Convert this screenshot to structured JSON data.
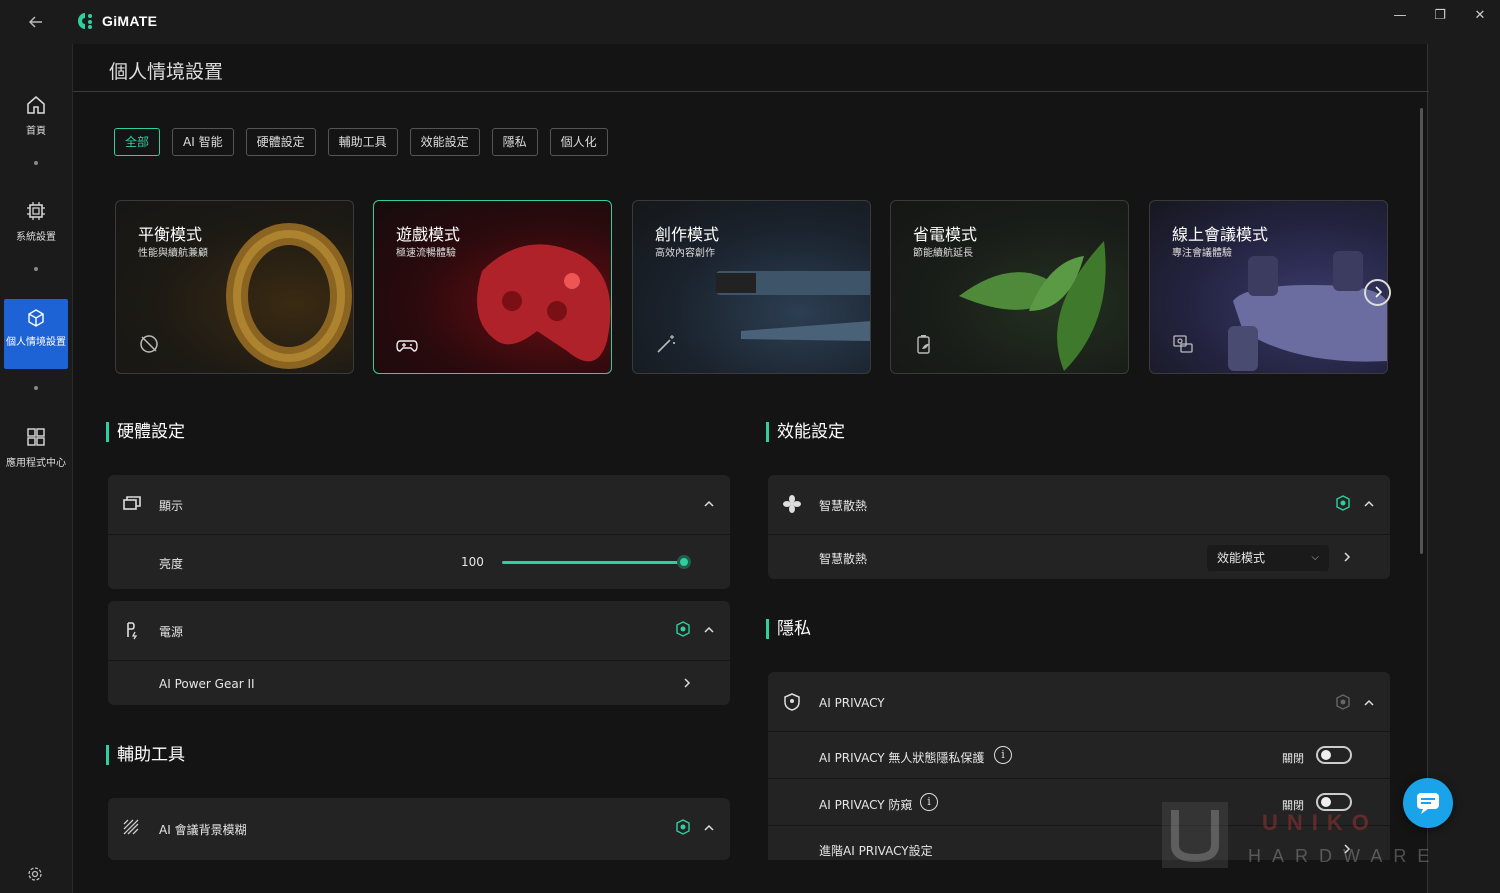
{
  "app": {
    "name": "GiMATE"
  },
  "window": {
    "minimize": "—",
    "restore": "❐",
    "close": "✕"
  },
  "sidebar": {
    "items": [
      {
        "label": "首頁",
        "icon": "home-icon"
      },
      {
        "label": "系統設置",
        "icon": "chip-icon"
      },
      {
        "label": "個人情境設置",
        "icon": "cube-icon"
      },
      {
        "label": "應用程式中心",
        "icon": "grid-icon"
      }
    ],
    "active_index": 2,
    "settings_icon": "gear-icon"
  },
  "page": {
    "title": "個人情境設置"
  },
  "filters": {
    "chips": [
      "全部",
      "AI 智能",
      "硬體設定",
      "輔助工具",
      "效能設定",
      "隱私",
      "個人化"
    ],
    "active_index": 0
  },
  "modes": [
    {
      "title": "平衡模式",
      "subtitle": "性能與續航兼顧",
      "icon": "balance-icon"
    },
    {
      "title": "遊戲模式",
      "subtitle": "極速流暢體驗",
      "icon": "gamepad-icon"
    },
    {
      "title": "創作模式",
      "subtitle": "高效內容創作",
      "icon": "magic-wand-icon"
    },
    {
      "title": "省電模式",
      "subtitle": "節能續航延長",
      "icon": "battery-leaf-icon"
    },
    {
      "title": "線上會議模式",
      "subtitle": "專注會議體驗",
      "icon": "meeting-icon"
    }
  ],
  "active_mode_index": 1,
  "hardware": {
    "title": "硬體設定",
    "display": {
      "label": "顯示",
      "brightness_label": "亮度",
      "brightness_value": "100",
      "brightness_fraction": 1.0
    },
    "power": {
      "label": "電源",
      "sub_label": "AI Power Gear II"
    }
  },
  "assist": {
    "title": "輔助工具",
    "ai_blur": {
      "label": "AI 會議背景模糊"
    }
  },
  "performance": {
    "title": "效能設定",
    "cooling": {
      "label": "智慧散熱",
      "sub_label": "智慧散熱",
      "select_value": "效能模式"
    }
  },
  "privacy": {
    "title": "隱私",
    "header": "AI PRIVACY",
    "rows": [
      {
        "label": "AI PRIVACY 無人狀態隱私保護",
        "state": "關閉"
      },
      {
        "label": "AI PRIVACY 防窺",
        "state": "關閉"
      }
    ],
    "advanced": "進階AI PRIVACY設定"
  },
  "watermark": {
    "top": "UNIKO",
    "bottom": "HARDWARE"
  },
  "colors": {
    "accent": "#2fcf9e",
    "nav_active": "#1e63d6",
    "fab": "#1aa3e8"
  }
}
